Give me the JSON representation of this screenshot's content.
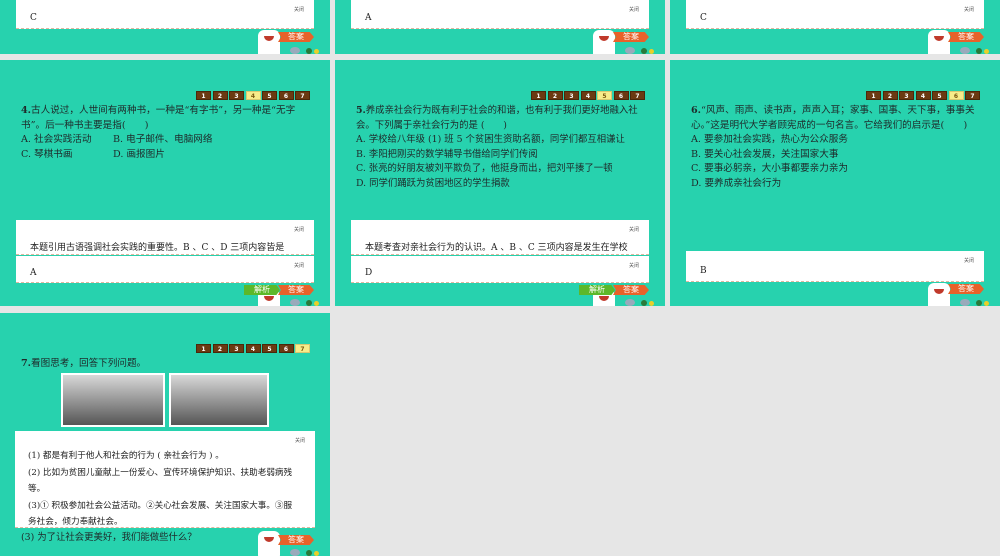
{
  "close_label": "关闭",
  "answer_btn": "答案",
  "analysis_btn": "解析",
  "nav_pages": [
    "1",
    "2",
    "3",
    "4",
    "5",
    "6",
    "7"
  ],
  "row1": [
    {
      "answer": "C"
    },
    {
      "answer": "A"
    },
    {
      "answer": "C"
    }
  ],
  "q4": {
    "num": "4.",
    "text": "古人说过，人世间有两种书，一种是“有字书”，另一种是“无字书”。后一种书主要是指(　　)",
    "options": [
      "A. 社会实践活动",
      "B. 电子邮件、电脑网络",
      "C. 琴棋书画",
      "D. 画报图片"
    ],
    "analysis": "本题引用古语强调社会实践的重要性。B 、C 、D 三项内容皆是",
    "answer": "A"
  },
  "q5": {
    "num": "5.",
    "text": "养成亲社会行为既有利于社会的和谐，也有利于我们更好地融入社会。下列属于亲社会行为的是 (　　)",
    "options": [
      "A. 学校给八年级 (1) 班 5 个贫困生资助名额，同学们都互相谦让",
      "B. 李阳把刚买的数学辅导书借给同学们传阅",
      "C. 张亮的好朋友被刘平欺负了，他挺身而出，把刘平揍了一顿",
      "D. 同学们踊跃为贫困地区的学生捐款"
    ],
    "analysis": "本题考查对亲社会行为的认识。A 、B 、C 三项内容是发生在学校",
    "answer": "D"
  },
  "q6": {
    "num": "6.",
    "text": "“风声、雨声、读书声，声声入耳；家事、国事、天下事，事事关心。”这是明代大学者顾宪成的一句名言。它给我们的启示是(　　)",
    "options": [
      "A. 要参加社会实践，热心为公众服务",
      "B. 要关心社会发展，关注国家大事",
      "C. 要事必躬亲，大小事都要亲力亲为",
      "D. 要养成亲社会行为"
    ],
    "answer": "B"
  },
  "q7": {
    "num": "7.",
    "text": "看图思考，回答下列问题。",
    "answers": [
      "(1) 都是有利于他人和社会的行为 ( 亲社会行为 ) 。",
      "(2) 比如为贫困儿童献上一份爱心、宣传环境保护知识、扶助老弱病残等。",
      "(3)① 积极参加社会公益活动。②关心社会发展、关注国家大事。③服务社会，倾力奉献社会。"
    ],
    "sub3": "(3) 为了让社会更美好，我们能做些什么？"
  }
}
